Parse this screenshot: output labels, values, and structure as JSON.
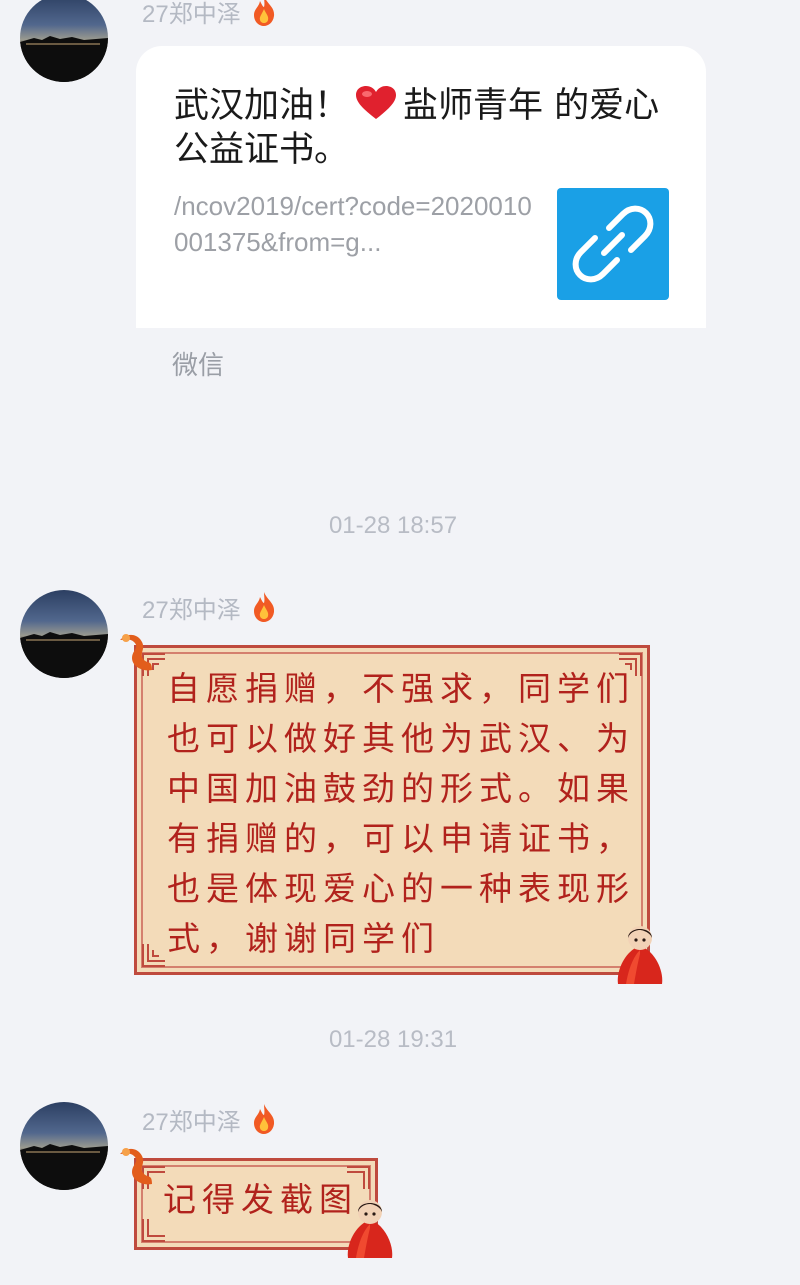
{
  "messages": [
    {
      "sender": "27郑中泽",
      "type": "link",
      "title_part1": "武汉加油！",
      "title_part2": "盐师青年 的爱心公益证书。",
      "url": "/ncov2019/cert?code=2020010001375&from=g...",
      "source": "微信"
    },
    {
      "timestamp": "01-28 18:57",
      "sender": "27郑中泽",
      "type": "text",
      "text": "自愿捐赠，不强求，同学们\n也可以做好其他为武汉、为\n中国加油鼓劲的形式。如果\n有捐赠的，可以申请证书，\n也是体现爱心的一种表现形\n式，谢谢同学们"
    },
    {
      "timestamp": "01-28 19:31",
      "sender": "27郑中泽",
      "type": "text",
      "text": "记得发截图"
    }
  ],
  "icons": {
    "flame": "flame-icon",
    "heart": "heart-icon",
    "link": "link-icon"
  },
  "colors": {
    "background": "#f2f3f7",
    "bubble_fill": "#f3dbb9",
    "bubble_border": "#bf4a3e",
    "bubble_text": "#b1221c",
    "link_thumb": "#1aa0e6"
  }
}
